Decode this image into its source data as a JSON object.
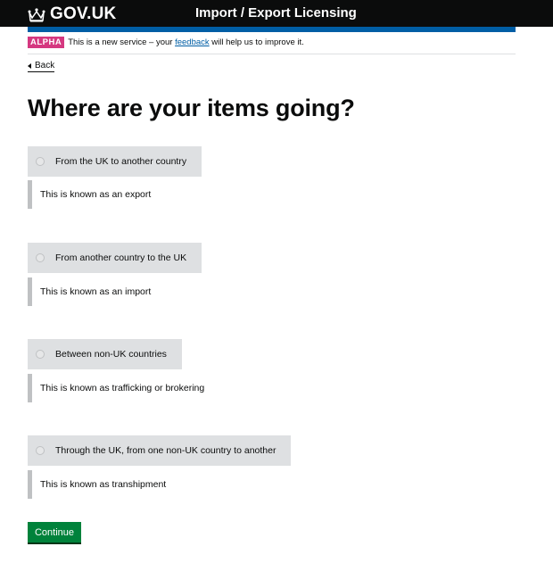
{
  "header": {
    "logo_text": "GOV.UK",
    "logo_icon": "crown-icon",
    "service_name": "Import / Export Licensing"
  },
  "phase_banner": {
    "tag": "ALPHA",
    "text_before": "This is a new service – your",
    "link_text": "feedback",
    "text_after": "will help us to improve it."
  },
  "back_link": {
    "label": "Back",
    "icon": "triangle-left-icon"
  },
  "page_title": "Where are your items going?",
  "options": [
    {
      "label": "From the UK to another country",
      "hint": "This is known as an export",
      "selected": false
    },
    {
      "label": "From another country to the UK",
      "hint": "This is known as an import",
      "selected": false
    },
    {
      "label": "Between non-UK countries",
      "hint": "This is known as trafficking or brokering",
      "selected": false
    },
    {
      "label": "Through the UK, from one non-UK country to another",
      "hint": "This is known as transhipment",
      "selected": false
    }
  ],
  "continue_label": "Continue",
  "colors": {
    "header_bg": "#0b0c0c",
    "brand_blue": "#005ea5",
    "alpha_tag": "#d53880",
    "option_bg": "#dee0e2",
    "hint_border": "#bfc1c3",
    "button_green": "#00823b"
  }
}
